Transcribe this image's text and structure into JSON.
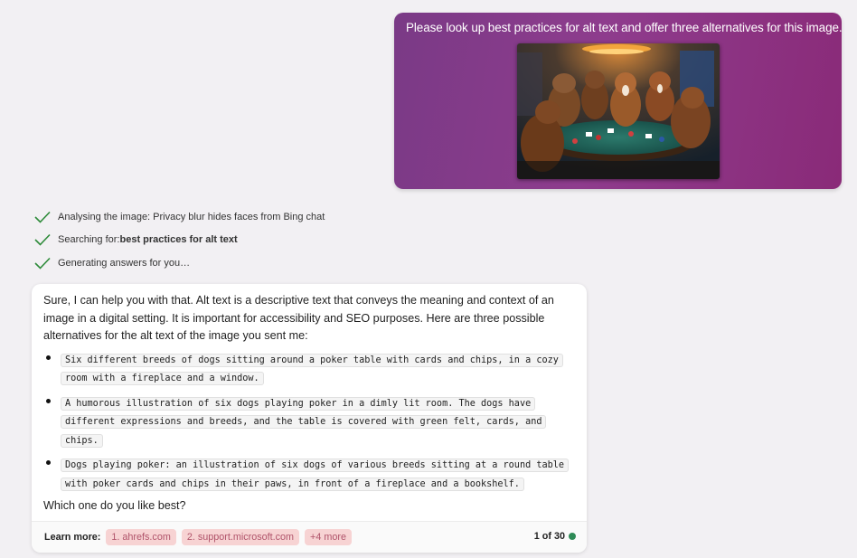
{
  "user_message": {
    "text": "Please look up best practices for alt text and offer three alternatives for this image.",
    "image_icon": "dogs-playing-poker-image"
  },
  "steps": [
    {
      "icon": "check-icon",
      "prefix": "Analysing the image: Privacy blur hides faces from Bing chat",
      "bold": ""
    },
    {
      "icon": "check-icon",
      "prefix": "Searching for: ",
      "bold": "best practices for alt text"
    },
    {
      "icon": "check-icon",
      "prefix": "Generating answers for you…",
      "bold": ""
    }
  ],
  "answer": {
    "intro": "Sure, I can help you with that. Alt text is a descriptive text that conveys the meaning and context of an image in a digital setting. It is important for accessibility and SEO purposes. Here are three possible alternatives for the alt text of the image you sent me:",
    "alternatives": [
      "Six different breeds of dogs sitting around a poker table with cards and chips, in a cozy room with a fireplace and a window.",
      "A humorous illustration of six dogs playing poker in a dimly lit room. The dogs have different expressions and breeds, and the table is covered with green felt, cards, and chips.",
      "Dogs playing poker: an illustration of six dogs of various breeds sitting at a round table with poker cards and chips in their paws, in front of a fireplace and a bookshelf."
    ],
    "question": "Which one do you like best?"
  },
  "learn_more": {
    "label": "Learn more:",
    "links": [
      "1. ahrefs.com",
      "2. support.microsoft.com",
      "+4 more"
    ],
    "count": "1 of 30"
  },
  "colors": {
    "accent": "#8e3c8d",
    "check": "#2e8b3a",
    "chip_bg": "#f7d3d3",
    "chip_text": "#b0536a",
    "status_dot": "#2e8b57"
  }
}
